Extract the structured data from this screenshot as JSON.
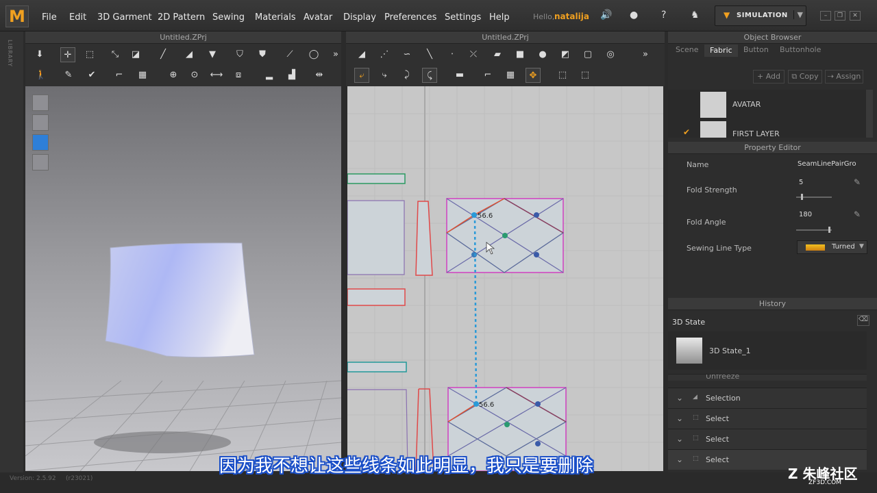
{
  "menubar": {
    "logo": "M",
    "items": [
      "File",
      "Edit",
      "3D Garment",
      "2D Pattern",
      "Sewing",
      "Materials",
      "Avatar",
      "Display",
      "Preferences",
      "Settings",
      "Help"
    ],
    "hello": "Hello,",
    "username": "natalija",
    "simulation_label": "SIMULATION"
  },
  "library": {
    "label": "LIBRARY"
  },
  "panel3d": {
    "title": "Untitled.ZPrj"
  },
  "panel2d": {
    "title": "Untitled.ZPrj",
    "measure_top": "56.6",
    "measure_bottom": "56.6"
  },
  "object_browser": {
    "title": "Object Browser",
    "tabs": [
      "Scene",
      "Fabric",
      "Button",
      "Buttonhole"
    ],
    "active_tab": "Fabric",
    "buttons": {
      "add": "Add",
      "copy": "Copy",
      "assign": "Assign"
    },
    "fabrics": [
      {
        "name": "AVATAR",
        "checked": false
      },
      {
        "name": "FIRST LAYER",
        "checked": true
      }
    ]
  },
  "property_editor": {
    "title": "Property Editor",
    "name_label": "Name",
    "name_value": "SeamLinePairGro",
    "fold_strength_label": "Fold Strength",
    "fold_strength_value": "5",
    "fold_angle_label": "Fold Angle",
    "fold_angle_value": "180",
    "sewing_line_type_label": "Sewing Line Type",
    "sewing_line_type_value": "Turned"
  },
  "history": {
    "title": "History",
    "state_header": "3D State",
    "state_item": "3D State_1",
    "items": [
      "Unfreeze",
      "Selection",
      "Select",
      "Select",
      "Select"
    ]
  },
  "status": {
    "version": "Version: 2.5.92",
    "build": "(r23021)"
  },
  "subtitle": "因为我不想让这些线条如此明显，我只是要删除",
  "watermark": {
    "brand": "朱峰社区",
    "url": "ZF3D.COM"
  },
  "colors": {
    "accent": "#f0a020",
    "pattern_pink": "#d040c0",
    "seam_blue": "#2a9ad8",
    "subtitle_outline": "#1a4fc8"
  }
}
